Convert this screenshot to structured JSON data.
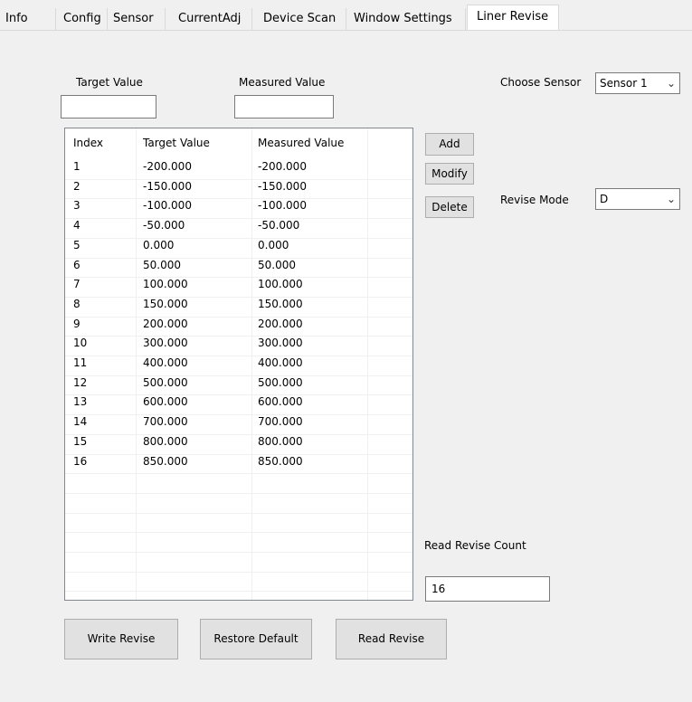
{
  "tabs": [
    {
      "label": "Info"
    },
    {
      "label": "Config"
    },
    {
      "label": "Sensor"
    },
    {
      "label": "CurrentAdj"
    },
    {
      "label": "Device Scan"
    },
    {
      "label": "Window Settings"
    },
    {
      "label": "Liner Revise"
    }
  ],
  "active_tab": "Liner Revise",
  "form": {
    "target_value_label": "Target Value",
    "target_value": "",
    "measured_value_label": "Measured Value",
    "measured_value": "",
    "choose_sensor_label": "Choose Sensor",
    "choose_sensor_value": "Sensor 1",
    "revise_mode_label": "Revise Mode",
    "revise_mode_value": "D"
  },
  "table": {
    "columns": [
      "Index",
      "Target Value",
      "Measured Value"
    ],
    "rows": [
      [
        "1",
        "-200.000",
        "-200.000"
      ],
      [
        "2",
        "-150.000",
        "-150.000"
      ],
      [
        "3",
        "-100.000",
        "-100.000"
      ],
      [
        "4",
        "-50.000",
        "-50.000"
      ],
      [
        "5",
        "0.000",
        "0.000"
      ],
      [
        "6",
        "50.000",
        "50.000"
      ],
      [
        "7",
        "100.000",
        "100.000"
      ],
      [
        "8",
        "150.000",
        "150.000"
      ],
      [
        "9",
        "200.000",
        "200.000"
      ],
      [
        "10",
        "300.000",
        "300.000"
      ],
      [
        "11",
        "400.000",
        "400.000"
      ],
      [
        "12",
        "500.000",
        "500.000"
      ],
      [
        "13",
        "600.000",
        "600.000"
      ],
      [
        "14",
        "700.000",
        "700.000"
      ],
      [
        "15",
        "800.000",
        "800.000"
      ],
      [
        "16",
        "850.000",
        "850.000"
      ]
    ]
  },
  "buttons": {
    "add": "Add",
    "modify": "Modify",
    "delete": "Delete",
    "write_revise": "Write Revise",
    "restore_default": "Restore Default",
    "read_revise": "Read Revise"
  },
  "read_revise_count_label": "Read Revise Count",
  "read_revise_count": "16"
}
